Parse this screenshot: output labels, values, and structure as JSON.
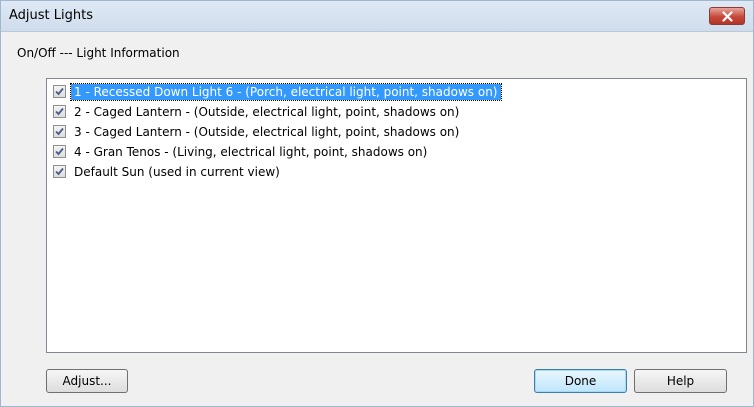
{
  "window": {
    "title": "Adjust Lights"
  },
  "header": {
    "label": "On/Off  ---  Light Information"
  },
  "lights": [
    {
      "checked": true,
      "label": "1 - Recessed Down Light 6 - (Porch, electrical light, point, shadows on)",
      "selected": true
    },
    {
      "checked": true,
      "label": "2 - Caged Lantern - (Outside, electrical light, point, shadows on)",
      "selected": false
    },
    {
      "checked": true,
      "label": "3 - Caged Lantern - (Outside, electrical light, point, shadows on)",
      "selected": false
    },
    {
      "checked": true,
      "label": "4 - Gran Tenos - (Living, electrical light, point, shadows on)",
      "selected": false
    },
    {
      "checked": true,
      "label": "Default Sun (used in current view)",
      "selected": false
    }
  ],
  "buttons": {
    "adjust": "Adjust...",
    "done": "Done",
    "help": "Help"
  },
  "colors": {
    "selection": "#3399ff",
    "close_button": "#c7493b"
  }
}
